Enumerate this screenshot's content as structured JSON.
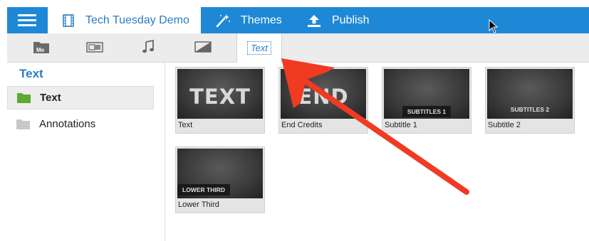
{
  "topbar": {
    "project_title": "Tech Tuesday Demo",
    "themes_label": "Themes",
    "publish_label": "Publish",
    "accent": "#1e88d6"
  },
  "toolbar": {
    "items": [
      {
        "icon": "media-folder-icon",
        "label": "Me"
      },
      {
        "icon": "transitions-icon"
      },
      {
        "icon": "music-icon"
      },
      {
        "icon": "filter-icon"
      },
      {
        "icon": "text-icon",
        "label": "Text",
        "selected": true
      }
    ]
  },
  "sidebar": {
    "title": "Text",
    "categories": [
      {
        "label": "Text",
        "icon": "folder-green-icon",
        "selected": true
      },
      {
        "label": "Annotations",
        "icon": "folder-gray-icon",
        "selected": false
      }
    ]
  },
  "tiles": [
    {
      "caption": "Text",
      "thumb_text": "TEXT"
    },
    {
      "caption": "End Credits",
      "thumb_text": "END"
    },
    {
      "caption": "Subtitle 1",
      "thumb_text": "SUBTITLES 1"
    },
    {
      "caption": "Subtitle 2",
      "thumb_text": "SUBTITLES 2"
    },
    {
      "caption": "Lower Third",
      "thumb_text": "LOWER THIRD"
    }
  ],
  "annotation": {
    "color": "#f03a22"
  }
}
